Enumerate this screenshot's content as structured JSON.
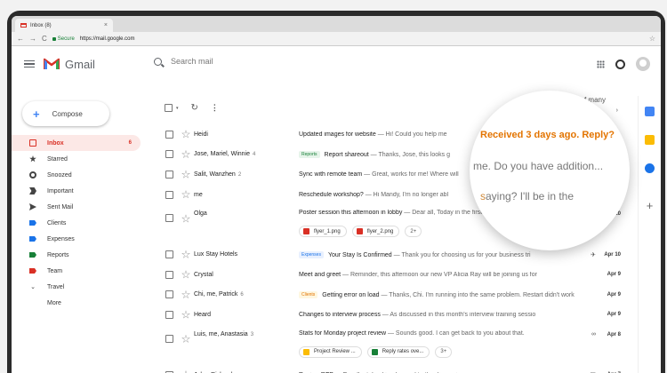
{
  "browser": {
    "tab_title": "Inbox (8)",
    "tab_close": "×",
    "secure_label": "Secure",
    "url": "https://mail.google.com",
    "nav_back": "←",
    "nav_forward": "→",
    "nav_reload": "C",
    "bookmark": "☆"
  },
  "header": {
    "brand": "Gmail",
    "search_placeholder": "Search mail"
  },
  "compose_label": "Compose",
  "sidebar": {
    "items": [
      {
        "label": "Inbox",
        "count": "6",
        "icon": "inbox-icon"
      },
      {
        "label": "Starred",
        "count": "",
        "icon": "star-icon"
      },
      {
        "label": "Snoozed",
        "count": "",
        "icon": "clock-icon"
      },
      {
        "label": "Important",
        "count": "",
        "icon": "important-icon"
      },
      {
        "label": "Sent Mail",
        "count": "",
        "icon": "send-icon"
      },
      {
        "label": "Clients",
        "count": "",
        "icon": "label-icon",
        "color": "#1a73e8"
      },
      {
        "label": "Expenses",
        "count": "",
        "icon": "label-icon",
        "color": "#1a73e8"
      },
      {
        "label": "Reports",
        "count": "",
        "icon": "label-icon",
        "color": "#188038"
      },
      {
        "label": "Team",
        "count": "",
        "icon": "label-icon",
        "color": "#d93025"
      },
      {
        "label": "Travel",
        "count": "",
        "icon": "chevron-down-icon"
      },
      {
        "label": "More",
        "count": "",
        "icon": ""
      }
    ]
  },
  "toolbar": {
    "caret": "▾",
    "refresh": "↻",
    "more": "⋮"
  },
  "pager": {
    "range": "1-25 of many",
    "next": "›"
  },
  "emails": [
    {
      "sender": "Heidi",
      "n": "",
      "tag": "",
      "subject": "Updated images for website",
      "snippet": " — Hi! Could you help me",
      "date": "",
      "icon": ""
    },
    {
      "sender": "Jose, Mariel, Winnie",
      "n": "4",
      "tag": "Reports",
      "subject": "Report shareout",
      "snippet": " — Thanks, Jose, this looks g",
      "date": "",
      "icon": ""
    },
    {
      "sender": "Salit, Wanzhen",
      "n": "2",
      "tag": "",
      "subject": "Sync with remote team",
      "snippet": " — Great, works for me! Where will",
      "date": "10",
      "icon": ""
    },
    {
      "sender": "me",
      "n": "",
      "tag": "",
      "subject": "Reschedule workshop?",
      "snippet": " — Hi Mandy, I'm no longer abl",
      "date": "",
      "icon": ""
    },
    {
      "sender": "Olga",
      "n": "",
      "tag": "",
      "subject": "Poster session this afternoon in lobby",
      "snippet": " — Dear all, Today in the first floor lobby we will",
      "date": "Apr 10",
      "icon": "∞",
      "attachments": [
        "flyer_1.png",
        "flyer_2.png"
      ],
      "more_attachments": "2+"
    },
    {
      "sender": "Lux Stay Hotels",
      "n": "",
      "tag": "Expenses",
      "subject": "Your Stay Is Confirmed",
      "snippet": " — Thank you for choosing us for your business tri",
      "date": "Apr 10",
      "icon": "✈"
    },
    {
      "sender": "Crystal",
      "n": "",
      "tag": "",
      "subject": "Meet and greet",
      "snippet": " — Reminder, this afternoon our new VP Alicia Ray will be joining us for",
      "date": "Apr 9",
      "icon": ""
    },
    {
      "sender": "Chi, me, Patrick",
      "n": "6",
      "tag": "Clients",
      "subject": "Getting error on load",
      "snippet": " — Thanks, Chi. I'm running into the same problem. Restart didn't work",
      "date": "Apr 9",
      "icon": ""
    },
    {
      "sender": "Heard",
      "n": "",
      "tag": "",
      "subject": "Changes to interview process",
      "snippet": " — As discussed in this month's interview training sessio",
      "date": "Apr 9",
      "icon": ""
    },
    {
      "sender": "Luis, me, Anastasia",
      "n": "3",
      "tag": "",
      "subject": "Stats for Monday project review",
      "snippet": " — Sounds good. I can get back to you about that.",
      "date": "Apr 8",
      "icon": "∞",
      "attachments": [
        "Project Review ...",
        "Reply rates ove..."
      ],
      "more_attachments": "3+"
    },
    {
      "sender": "John, Richard, me",
      "n": "5",
      "tag": "",
      "subject": "Review RFP",
      "snippet": " — Excellent. Looking forward to the discussion.",
      "date": "Apr 7",
      "icon": "▣"
    }
  ],
  "tag_colors": {
    "Reports": {
      "bg": "#e6f4ea",
      "fg": "#188038"
    },
    "Expenses": {
      "bg": "#e8f0fe",
      "fg": "#1a73e8"
    },
    "Clients": {
      "bg": "#fef7e0",
      "fg": "#e37400"
    }
  },
  "magnifier": {
    "nudge": "Received 3 days ago. Reply?",
    "line2": "me. Do you have addition...",
    "line3_a": "s",
    "line3_b": "aying? I'll be in the"
  },
  "rail": {
    "add": "+"
  }
}
